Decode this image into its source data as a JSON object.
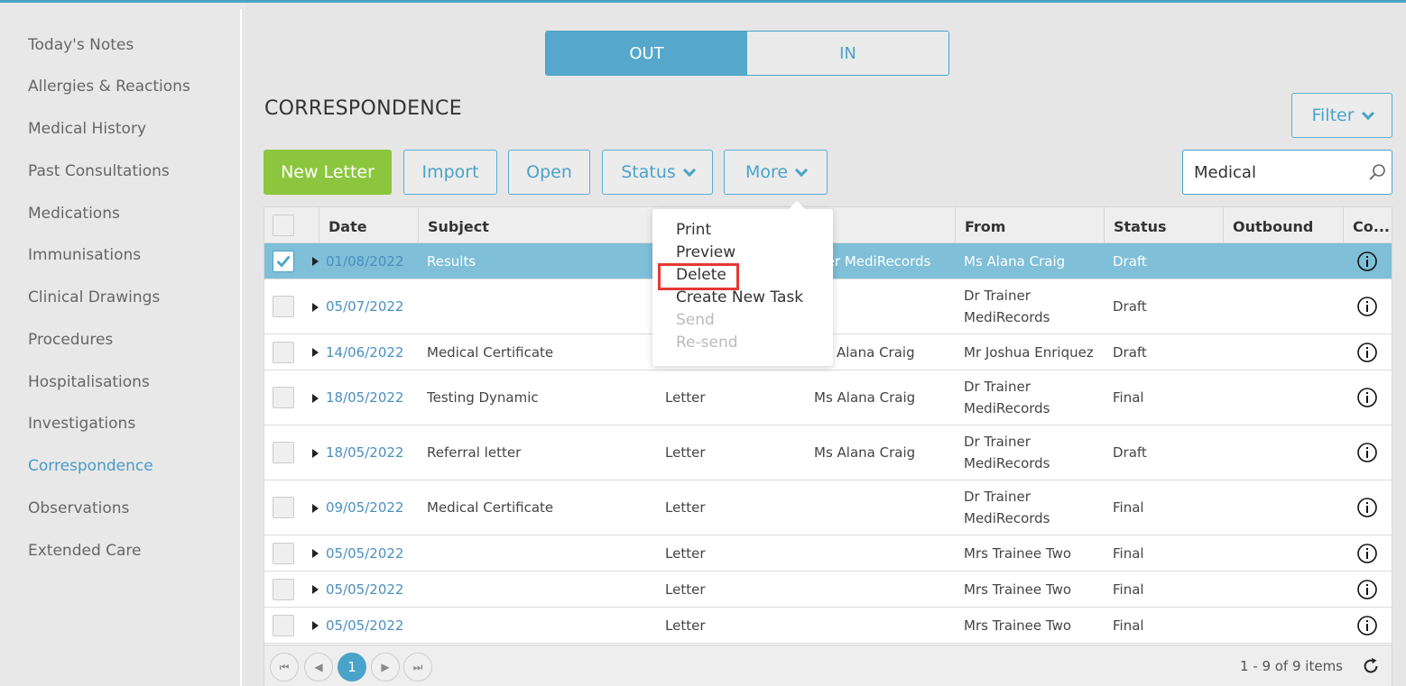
{
  "sidebar": {
    "items": [
      {
        "label": "Today's Notes"
      },
      {
        "label": "Allergies & Reactions"
      },
      {
        "label": "Medical History"
      },
      {
        "label": "Past Consultations"
      },
      {
        "label": "Medications"
      },
      {
        "label": "Immunisations"
      },
      {
        "label": "Clinical Drawings"
      },
      {
        "label": "Procedures"
      },
      {
        "label": "Hospitalisations"
      },
      {
        "label": "Investigations"
      },
      {
        "label": "Correspondence",
        "active": true
      },
      {
        "label": "Observations"
      },
      {
        "label": "Extended Care"
      }
    ]
  },
  "toggle": {
    "out_label": "OUT",
    "in_label": "IN",
    "selected": "OUT"
  },
  "section_title": "CORRESPONDENCE",
  "toolbar": {
    "new_letter": "New Letter",
    "import": "Import",
    "open": "Open",
    "status": "Status",
    "more": "More",
    "filter": "Filter"
  },
  "search": {
    "value": "Medical"
  },
  "grid": {
    "columns": [
      "Date",
      "Subject",
      "From",
      "Status",
      "Outbound",
      "Co..."
    ],
    "rows": [
      {
        "date": "01/08/2022",
        "subject": "Results",
        "type": "",
        "to": "iner MediRecords",
        "from": "Ms Alana Craig",
        "status": "Draft",
        "selected": true
      },
      {
        "date": "05/07/2022",
        "subject": "",
        "type": "",
        "to": "",
        "from": "Dr Trainer MediRecords",
        "status": "Draft"
      },
      {
        "date": "14/06/2022",
        "subject": "Medical Certificate",
        "type": "",
        "to": "Alana Craig",
        "from": "Mr Joshua Enriquez",
        "status": "Draft"
      },
      {
        "date": "18/05/2022",
        "subject": "Testing Dynamic",
        "type": "Letter",
        "to": "Ms Alana Craig",
        "from": "Dr Trainer MediRecords",
        "status": "Final"
      },
      {
        "date": "18/05/2022",
        "subject": "Referral letter",
        "type": "Letter",
        "to": "Ms Alana Craig",
        "from": "Dr Trainer MediRecords",
        "status": "Draft"
      },
      {
        "date": "09/05/2022",
        "subject": "Medical Certificate",
        "type": "Letter",
        "to": "",
        "from": "Dr Trainer MediRecords",
        "status": "Final"
      },
      {
        "date": "05/05/2022",
        "subject": "",
        "type": "Letter",
        "to": "",
        "from": "Mrs Trainee Two",
        "status": "Final"
      },
      {
        "date": "05/05/2022",
        "subject": "",
        "type": "Letter",
        "to": "",
        "from": "Mrs Trainee Two",
        "status": "Final"
      },
      {
        "date": "05/05/2022",
        "subject": "",
        "type": "Letter",
        "to": "",
        "from": "Mrs Trainee Two",
        "status": "Final"
      }
    ]
  },
  "pager": {
    "current_page": "1",
    "info": "1 - 9 of 9 items"
  },
  "more_menu": {
    "items": [
      {
        "label": "Print",
        "enabled": true
      },
      {
        "label": "Preview",
        "enabled": true
      },
      {
        "label": "Delete",
        "enabled": true,
        "highlighted": true
      },
      {
        "label": "Create New Task",
        "enabled": true
      },
      {
        "label": "Send",
        "enabled": false
      },
      {
        "label": "Re-send",
        "enabled": false
      }
    ]
  },
  "colors": {
    "accent": "#4aa3c8",
    "primary_button": "#8cc63f",
    "selected_row": "#7fbfd8",
    "highlight": "#e53935"
  }
}
